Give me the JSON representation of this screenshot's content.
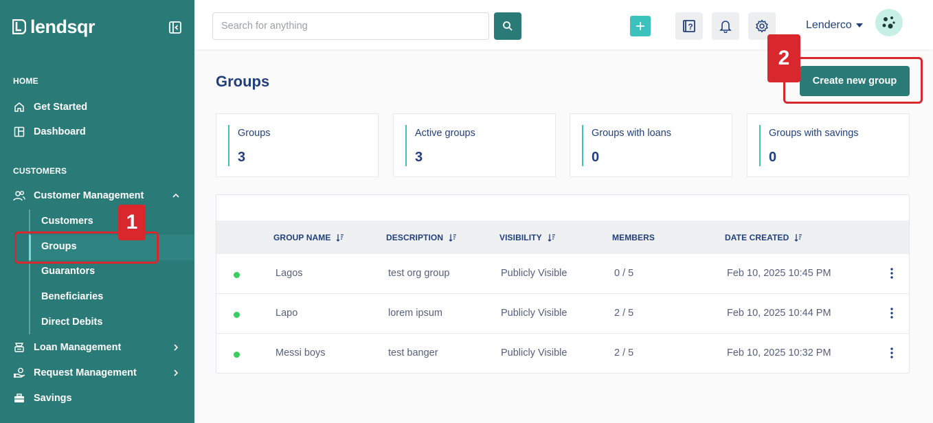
{
  "sidebar": {
    "logo_text": "lendsqr",
    "sections": {
      "home": "HOME",
      "customers": "CUSTOMERS"
    },
    "items": {
      "get_started": "Get Started",
      "dashboard": "Dashboard",
      "customer_management": "Customer Management",
      "loan_management": "Loan Management",
      "request_management": "Request Management",
      "savings": "Savings"
    },
    "sub_items": [
      "Customers",
      "Groups",
      "Guarantors",
      "Beneficiaries",
      "Direct Debits"
    ],
    "active_sub_item": "Groups"
  },
  "header": {
    "search_placeholder": "Search for anything",
    "user_name": "Lenderco"
  },
  "main": {
    "title": "Groups",
    "create_button": "Create new group",
    "stats": [
      {
        "label": "Groups",
        "value": "3"
      },
      {
        "label": "Active groups",
        "value": "3"
      },
      {
        "label": "Groups with loans",
        "value": "0"
      },
      {
        "label": "Groups with savings",
        "value": "0"
      }
    ],
    "table": {
      "columns": [
        "GROUP NAME",
        "DESCRIPTION",
        "VISIBILITY",
        "MEMBERS",
        "DATE CREATED"
      ],
      "rows": [
        {
          "name": "Lagos",
          "description": "test org group",
          "visibility": "Publicly Visible",
          "members": "0 / 5",
          "date": "Feb 10, 2025 10:45 PM"
        },
        {
          "name": "Lapo",
          "description": "lorem ipsum",
          "visibility": "Publicly Visible",
          "members": "2 / 5",
          "date": "Feb 10, 2025 10:44 PM"
        },
        {
          "name": "Messi boys",
          "description": "test banger",
          "visibility": "Publicly Visible",
          "members": "2 / 5",
          "date": "Feb 10, 2025 10:32 PM"
        }
      ]
    }
  },
  "annotations": {
    "step1": "1",
    "step2": "2"
  },
  "colors": {
    "sidebar_bg": "#2a7a78",
    "accent": "#3cc2bd",
    "title": "#213f7d",
    "highlight": "#d9272e",
    "status_active": "#39cd62"
  }
}
